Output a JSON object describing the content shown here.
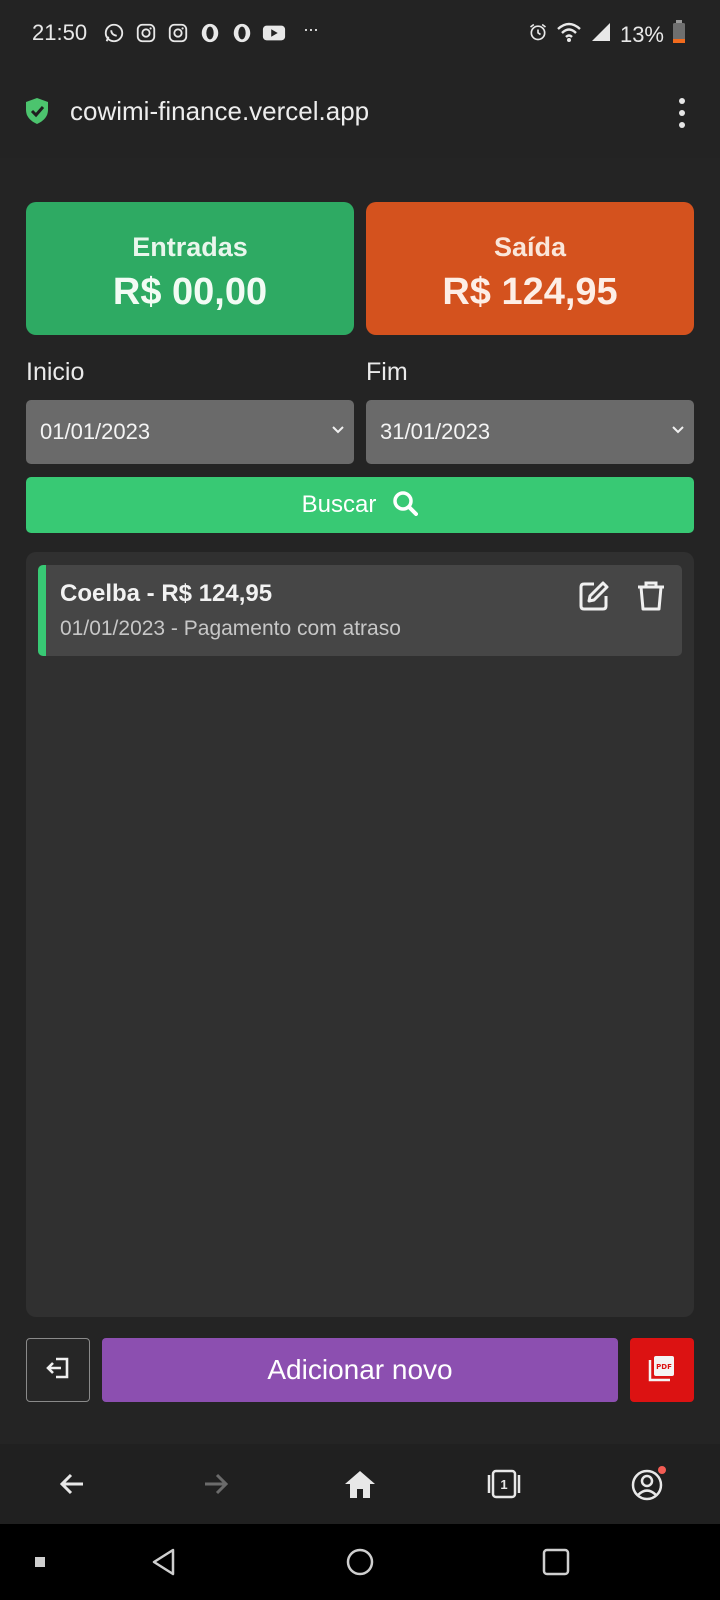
{
  "status_bar": {
    "time": "21:50",
    "notification_icons": [
      "whatsapp-icon",
      "instagram-icon",
      "instagram-icon",
      "opera-icon",
      "opera-icon",
      "youtube-icon"
    ],
    "more_indicator": "···",
    "battery_text": "13%",
    "battery_color": "#f26b1d"
  },
  "browser": {
    "url": "cowimi-finance.vercel.app",
    "secure_color": "#4cc46e"
  },
  "summary": {
    "income": {
      "title": "Entradas",
      "value": "R$ 00,00",
      "color": "#2eaa63"
    },
    "expense": {
      "title": "Saída",
      "value": "R$ 124,95",
      "color": "#d4521e"
    }
  },
  "filters": {
    "start": {
      "label": "Inicio",
      "value": "01/01/2023"
    },
    "end": {
      "label": "Fim",
      "value": "31/01/2023"
    },
    "search_label": "Buscar",
    "search_color": "#38c974"
  },
  "transactions": [
    {
      "title": "Coelba - R$ 124,95",
      "subtitle": "01/01/2023 - Pagamento com atraso",
      "accent": "#38c974"
    }
  ],
  "actions": {
    "add_label": "Adicionar novo",
    "add_color": "#8c4fb0",
    "pdf_color": "#dc1212",
    "pdf_text": "PDF"
  },
  "bottom_nav": {
    "tab_count": "1",
    "profile_dot_color": "#f25c54"
  }
}
